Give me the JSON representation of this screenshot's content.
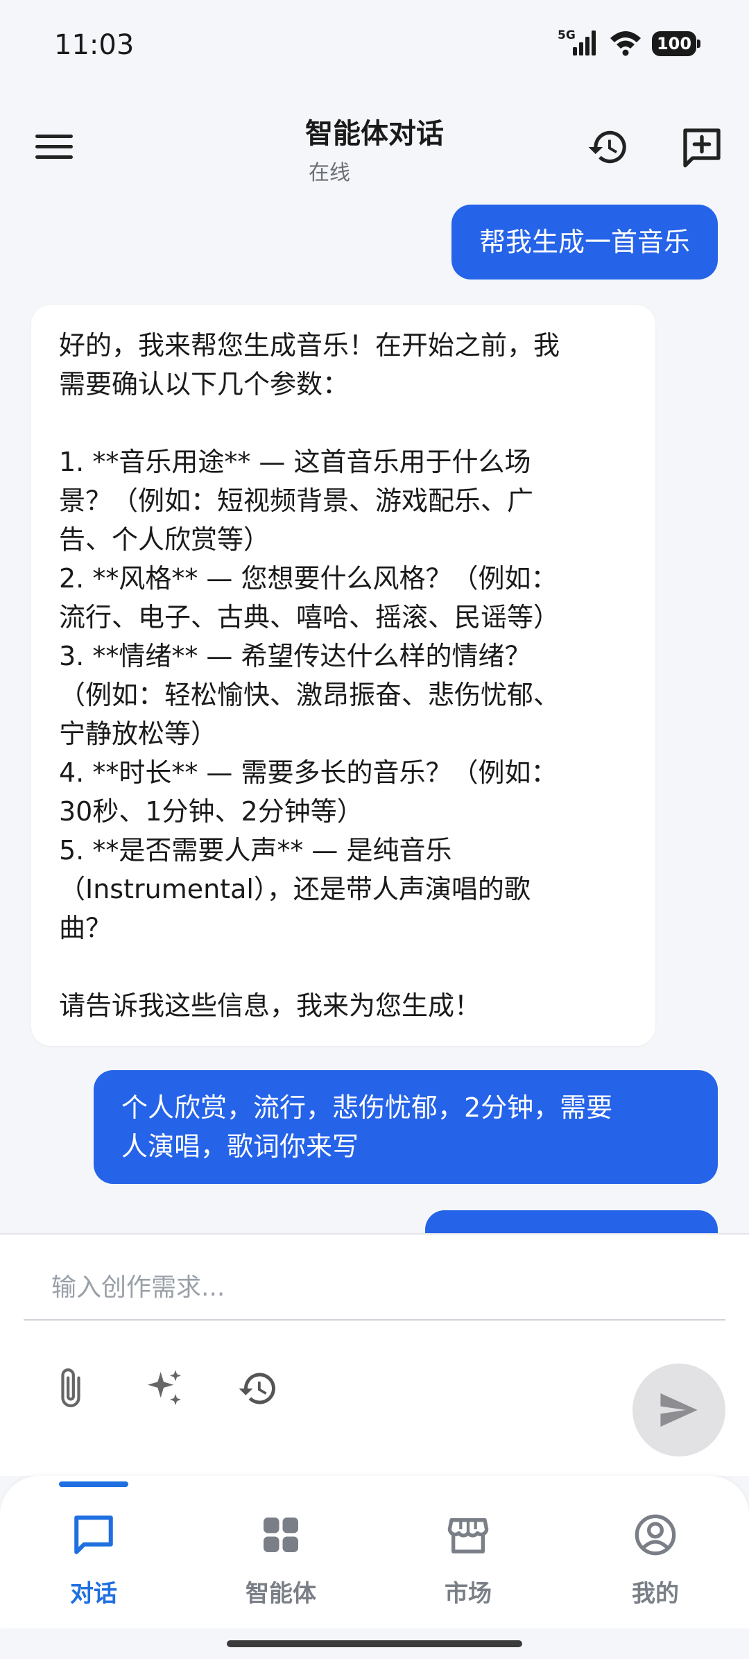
{
  "status_bar": {
    "time": "11:03",
    "network": "5G",
    "battery": "100"
  },
  "header": {
    "title": "智能体对话",
    "status": "在线"
  },
  "messages": [
    {
      "role": "user",
      "text": "帮我生成一首音乐"
    },
    {
      "role": "assistant",
      "lines": [
        "好的，我来帮您生成音乐！在开始之前，我",
        "需要确认以下几个参数：",
        "",
        "1. **音乐用途** — 这首音乐用于什么场",
        "景？（例如：短视频背景、游戏配乐、广",
        "告、个人欣赏等）",
        "2. **风格** — 您想要什么风格？（例如：",
        "流行、电子、古典、嘻哈、摇滚、民谣等）",
        "3. **情绪** — 希望传达什么样的情绪？",
        "（例如：轻松愉快、激昂振奋、悲伤忧郁、",
        "宁静放松等）",
        "4. **时长** — 需要多长的音乐？（例如：",
        "30秒、1分钟、2分钟等）",
        "5. **是否需要人声** — 是纯音乐",
        "（Instrumental），还是带人声演唱的歌",
        "曲？",
        "",
        "请告诉我这些信息，我来为您生成！"
      ]
    },
    {
      "role": "user",
      "lines": [
        "个人欣赏，流行，悲伤忧郁，2分钟，需要",
        "人演唱，歌词你来写"
      ]
    }
  ],
  "composer": {
    "placeholder": "输入创作需求..."
  },
  "nav": {
    "items": [
      {
        "label": "对话",
        "icon": "chat-icon",
        "active": true
      },
      {
        "label": "智能体",
        "icon": "grid-icon",
        "active": false
      },
      {
        "label": "市场",
        "icon": "store-icon",
        "active": false
      },
      {
        "label": "我的",
        "icon": "profile-icon",
        "active": false
      }
    ]
  },
  "colors": {
    "accent": "#2563e8",
    "nav_active": "#1f6fe0",
    "background": "#f4f6f9"
  }
}
